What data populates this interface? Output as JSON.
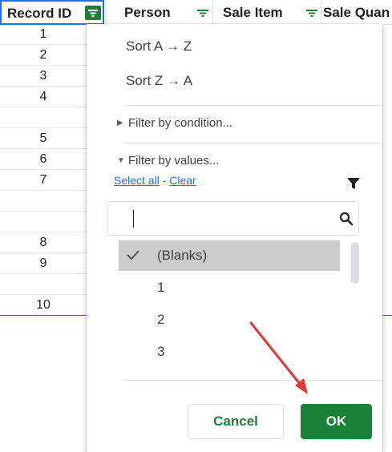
{
  "columns": [
    {
      "label": "Record ID",
      "filter_active": true
    },
    {
      "label": "Person",
      "filter_active": false
    },
    {
      "label": "Sale Item",
      "filter_active": false
    },
    {
      "label": "Sale Quan",
      "filter_active": false
    }
  ],
  "record_rows": [
    "1",
    "2",
    "3",
    "4",
    "",
    "5",
    "6",
    "7",
    "",
    "8",
    "9",
    "",
    "10"
  ],
  "filter_menu": {
    "sort_asc": "Sort A → Z",
    "sort_desc": "Sort Z → A",
    "filter_by_condition": "Filter by condition...",
    "filter_by_values": "Filter by values...",
    "select_all": "Select all",
    "separator": " - ",
    "clear": "Clear",
    "search_value": "",
    "values": [
      {
        "label": "(Blanks)",
        "checked": true
      },
      {
        "label": "1",
        "checked": false
      },
      {
        "label": "2",
        "checked": false
      },
      {
        "label": "3",
        "checked": false
      }
    ],
    "cancel_label": "Cancel",
    "ok_label": "OK"
  },
  "colors": {
    "accent_green": "#188038",
    "link_blue": "#1a73e8",
    "annotation_red": "#e53935"
  }
}
